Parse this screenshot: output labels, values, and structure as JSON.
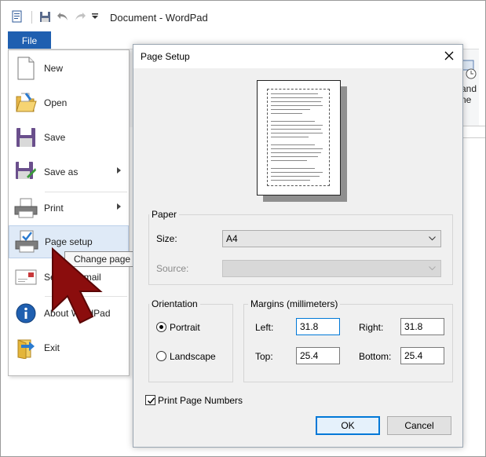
{
  "window": {
    "title": "Document - WordPad",
    "file_tab": "File",
    "ribbon_partial_label_1": "and",
    "ribbon_partial_label_2": "ne"
  },
  "file_menu": {
    "items": [
      {
        "label": "New",
        "icon": "new-document-icon",
        "has_submenu": false
      },
      {
        "label": "Open",
        "icon": "open-folder-icon",
        "has_submenu": false
      },
      {
        "label": "Save",
        "icon": "save-disk-icon",
        "has_submenu": false
      },
      {
        "label": "Save as",
        "icon": "save-as-icon",
        "has_submenu": true
      },
      {
        "label": "Print",
        "icon": "printer-icon",
        "has_submenu": true
      },
      {
        "label": "Page setup",
        "icon": "page-setup-icon",
        "has_submenu": false,
        "highlighted": true
      },
      {
        "label": "Send in email",
        "icon": "email-icon",
        "has_submenu": false
      },
      {
        "label": "About WordPad",
        "icon": "info-icon",
        "has_submenu": false
      },
      {
        "label": "Exit",
        "icon": "exit-icon",
        "has_submenu": false
      }
    ],
    "tooltip": "Change page layout settings"
  },
  "dialog": {
    "title": "Page Setup",
    "paper_group": "Paper",
    "size_label": "Size:",
    "size_value": "A4",
    "source_label": "Source:",
    "source_value": "",
    "orientation_group": "Orientation",
    "portrait_label": "Portrait",
    "landscape_label": "Landscape",
    "orientation_selected": "Portrait",
    "margins_group": "Margins (millimeters)",
    "left_label": "Left:",
    "left_value": "31.8",
    "right_label": "Right:",
    "right_value": "31.8",
    "top_label": "Top:",
    "top_value": "25.4",
    "bottom_label": "Bottom:",
    "bottom_value": "25.4",
    "print_page_numbers_label": "Print Page Numbers",
    "print_page_numbers_checked": true,
    "ok_label": "OK",
    "cancel_label": "Cancel"
  },
  "colors": {
    "file_tab": "#1f5fb0",
    "menu_highlight": "#dfeaf7",
    "dialog_bg": "#f0f0f0",
    "focus_border": "#0078d7",
    "cursor_fill": "#8b0d0d"
  }
}
